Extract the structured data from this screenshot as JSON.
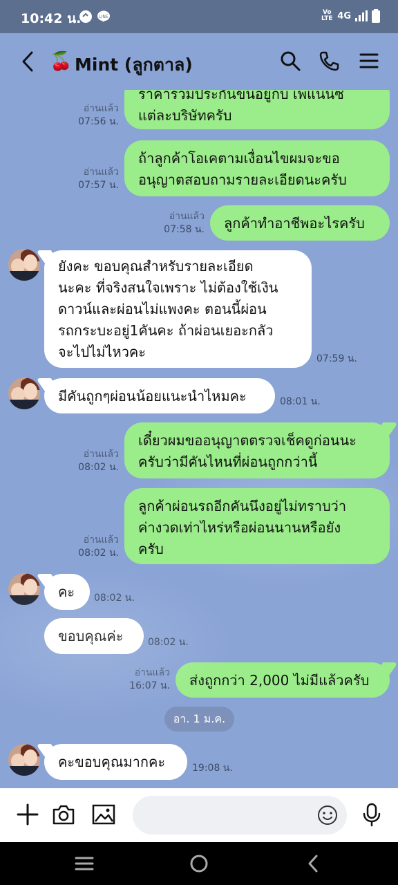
{
  "status": {
    "time": "10:42 น.",
    "network": "4G",
    "volte": "VoLTE"
  },
  "header": {
    "back_icon": "chevron-left-icon",
    "title": "Mint (ลูกตาล)",
    "emoji": "🍒"
  },
  "messages": [
    {
      "dir": "out",
      "lines": [
        "ราคารวมประกันขนอยูกบ เพแนนซ",
        "แต่ละบริษัทครับ"
      ],
      "read": "อ่านแล้ว",
      "time": "07:56 น."
    },
    {
      "dir": "out",
      "lines": [
        "ถ้าลูกค้าโอเคตามเงื่อนไขผมจะขอ",
        "อนุญาตสอบถามรายละเอียดนะครับ"
      ],
      "read": "อ่านแล้ว",
      "time": "07:57 น."
    },
    {
      "dir": "out",
      "lines": [
        "ลูกค้าทำอาชีพอะไรครับ"
      ],
      "read": "อ่านแล้ว",
      "time": "07:58 น."
    },
    {
      "dir": "in",
      "lines": [
        "ยังคะ  ขอบคุณสำหรับรายละเอียด",
        "นะคะ ที่จริงสนใจเพราะ ไม่ต้องใช้เงิน",
        "ดาวน์และผ่อนไม่แพงคะ ตอนนี้ผ่อน",
        "รถกระบะอยู่1คันคะ ถ้าผ่อนเยอะกลัว",
        "จะไปไม่ไหวคะ"
      ],
      "time": "07:59 น."
    },
    {
      "dir": "in",
      "lines": [
        "มีคันถูกๆผ่อนน้อยแนะนำไหมคะ"
      ],
      "time": "08:01 น."
    },
    {
      "dir": "out",
      "lines": [
        "เดี๋ยวผมขออนุญาตตรวจเช็คดูก่อนนะ",
        "ครับว่ามีคันไหนที่ผ่อนถูกกว่านี้"
      ],
      "read": "อ่านแล้ว",
      "time": "08:02 น."
    },
    {
      "dir": "out",
      "lines": [
        "ลูกค้าผ่อนรถอีกคันนึงอยู่ไม่ทราบว่า",
        "ค่างวดเท่าไหร่หรือผ่อนนานหรือยัง",
        "ครับ"
      ],
      "read": "อ่านแล้ว",
      "time": "08:02 น."
    },
    {
      "dir": "in",
      "lines": [
        "คะ"
      ],
      "time": "08:02 น."
    },
    {
      "dir": "in",
      "lines": [
        "ขอบคุณค่ะ"
      ],
      "time": "08:02 น."
    },
    {
      "dir": "out",
      "lines": [
        "ส่งถูกกว่า 2,000 ไม่มีแล้วครับ"
      ],
      "read": "อ่านแล้ว",
      "time": "16:07 น."
    },
    {
      "dir": "in",
      "lines": [
        "คะขอบคุณมากคะ"
      ],
      "time": "19:08 น."
    }
  ],
  "date_chip": "อา. 1 ม.ค.",
  "input": {
    "placeholder": "",
    "value": ""
  },
  "colors": {
    "chat_bg": "#8aa4d6",
    "outgoing_bubble": "#9bec8a",
    "incoming_bubble": "#ffffff"
  }
}
